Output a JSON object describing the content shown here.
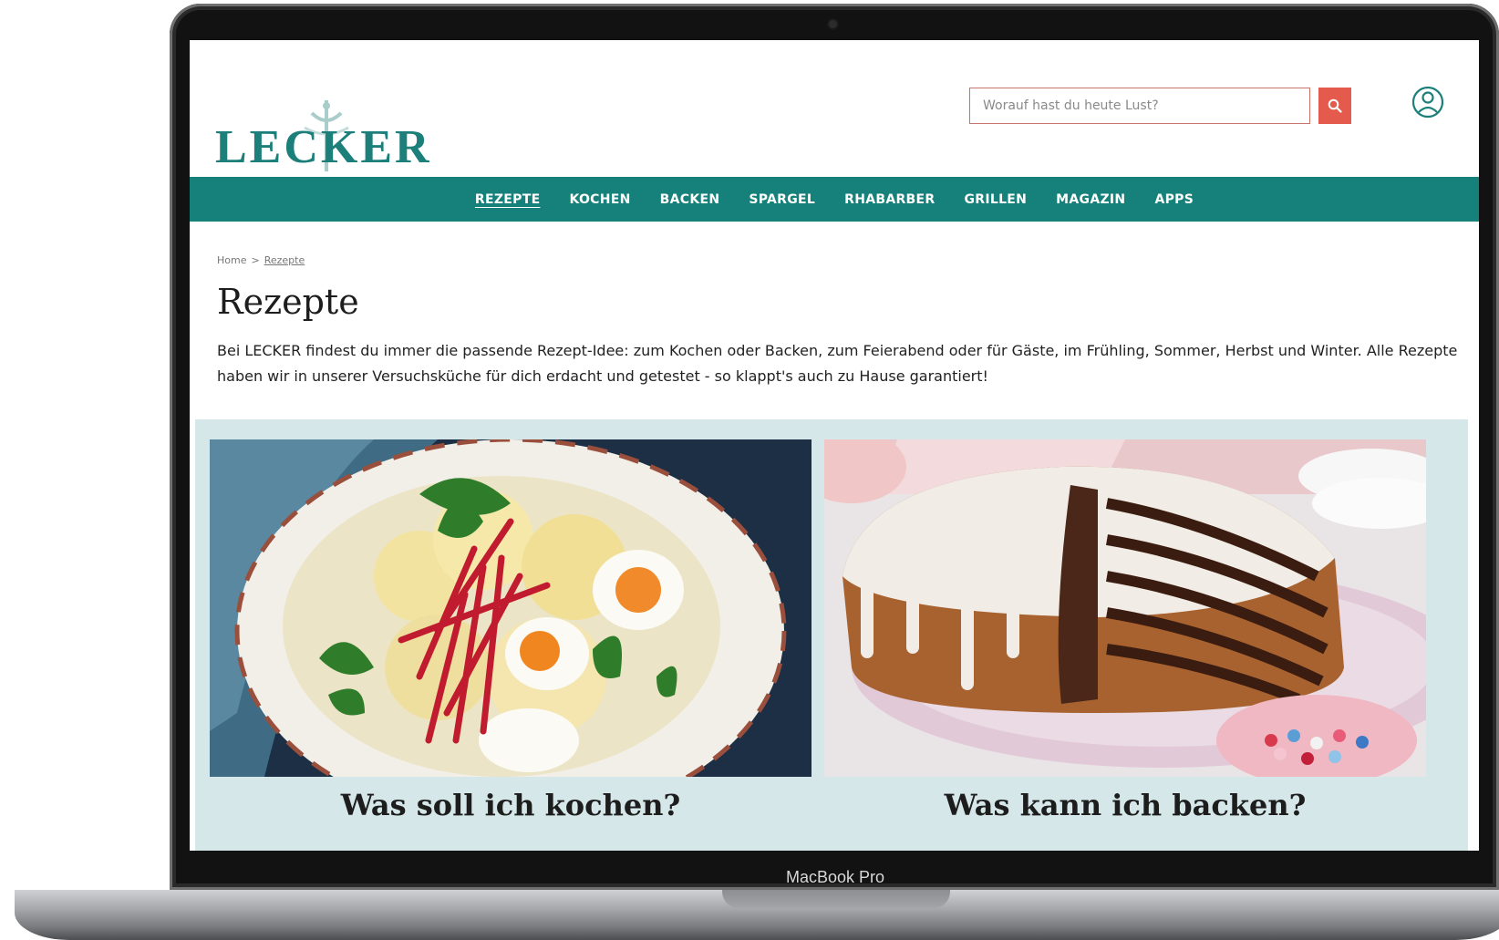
{
  "device": {
    "label": "MacBook Pro"
  },
  "site": {
    "logo_text": "LECKER",
    "brand_color": "#16807b",
    "accent_color": "#e45a4c"
  },
  "search": {
    "placeholder": "Worauf hast du heute Lust?",
    "icon": "search-icon"
  },
  "account": {
    "icon": "user-icon"
  },
  "nav": {
    "items": [
      {
        "label": "REZEPTE",
        "active": true
      },
      {
        "label": "KOCHEN"
      },
      {
        "label": "BACKEN"
      },
      {
        "label": "SPARGEL"
      },
      {
        "label": "RHABARBER"
      },
      {
        "label": "GRILLEN"
      },
      {
        "label": "MAGAZIN"
      },
      {
        "label": "APPS"
      }
    ]
  },
  "breadcrumb": {
    "home": "Home",
    "separator": ">",
    "current": "Rezepte"
  },
  "page": {
    "title": "Rezepte",
    "intro": "Bei LECKER findest du immer die passende Rezept-Idee: zum Kochen oder Backen, zum Feierabend oder für Gäste, im Frühling, Sommer, Herbst und Winter. Alle Rezepte haben wir in unserer Versuchsküche für dich erdacht und getestet - so klappt's auch zu Hause garantiert!"
  },
  "teasers": [
    {
      "title": "Was soll ich kochen?",
      "image": "potato-salad-with-eggs-and-beetroot"
    },
    {
      "title": "Was kann ich backen?",
      "image": "zebra-cake-with-icing"
    }
  ]
}
